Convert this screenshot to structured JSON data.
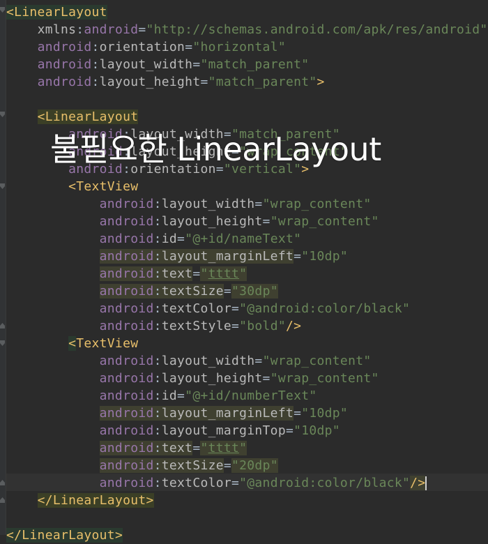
{
  "overlay_caption": "불필요한 LinearLayout",
  "lines": [
    {
      "indent": "",
      "parts": [
        {
          "c": "bracket tagbg2",
          "t": "<"
        },
        {
          "c": "tag tagbg2",
          "t": "LinearLayout"
        }
      ]
    },
    {
      "indent": "    ",
      "parts": [
        {
          "c": "plain",
          "t": "xmlns"
        },
        {
          "c": "colon",
          "t": ":"
        },
        {
          "c": "attr",
          "t": "android"
        },
        {
          "c": "eq",
          "t": "="
        },
        {
          "c": "val",
          "t": "\"http://schemas.android.com/apk/res/android\""
        }
      ]
    },
    {
      "indent": "    ",
      "parts": [
        {
          "c": "attr",
          "t": "android"
        },
        {
          "c": "colon",
          "t": ":"
        },
        {
          "c": "plain",
          "t": "orientation"
        },
        {
          "c": "eq",
          "t": "="
        },
        {
          "c": "val",
          "t": "\"horizontal\""
        }
      ]
    },
    {
      "indent": "    ",
      "parts": [
        {
          "c": "attr",
          "t": "android"
        },
        {
          "c": "colon",
          "t": ":"
        },
        {
          "c": "plain",
          "t": "layout_width"
        },
        {
          "c": "eq",
          "t": "="
        },
        {
          "c": "val",
          "t": "\"match_parent\""
        }
      ]
    },
    {
      "indent": "    ",
      "parts": [
        {
          "c": "attr",
          "t": "android"
        },
        {
          "c": "colon",
          "t": ":"
        },
        {
          "c": "plain",
          "t": "layout_height"
        },
        {
          "c": "eq",
          "t": "="
        },
        {
          "c": "val",
          "t": "\"match_parent\""
        },
        {
          "c": "bracket",
          "t": ">"
        }
      ]
    },
    {
      "indent": "",
      "parts": []
    },
    {
      "indent": "    ",
      "parts": [
        {
          "c": "bracket tagbg",
          "t": "<"
        },
        {
          "c": "tag tagbg",
          "t": "LinearLayout"
        }
      ]
    },
    {
      "indent": "        ",
      "parts": [
        {
          "c": "attr",
          "t": "android"
        },
        {
          "c": "colon",
          "t": ":"
        },
        {
          "c": "plain",
          "t": "layout_width"
        },
        {
          "c": "eq",
          "t": "="
        },
        {
          "c": "val",
          "t": "\"match_parent\""
        }
      ]
    },
    {
      "indent": "        ",
      "parts": [
        {
          "c": "attr",
          "t": "android"
        },
        {
          "c": "colon",
          "t": ":"
        },
        {
          "c": "plain",
          "t": "layout_height"
        },
        {
          "c": "eq",
          "t": "="
        },
        {
          "c": "val",
          "t": "\"wrap_content\""
        }
      ]
    },
    {
      "indent": "        ",
      "parts": [
        {
          "c": "attr",
          "t": "android"
        },
        {
          "c": "colon",
          "t": ":"
        },
        {
          "c": "plain",
          "t": "orientation"
        },
        {
          "c": "eq",
          "t": "="
        },
        {
          "c": "val",
          "t": "\"vertical\""
        },
        {
          "c": "bracket",
          "t": ">"
        }
      ]
    },
    {
      "indent": "        ",
      "parts": [
        {
          "c": "bracket",
          "t": "<"
        },
        {
          "c": "tag",
          "t": "TextView"
        }
      ]
    },
    {
      "indent": "            ",
      "parts": [
        {
          "c": "attr",
          "t": "android"
        },
        {
          "c": "colon",
          "t": ":"
        },
        {
          "c": "plain",
          "t": "layout_width"
        },
        {
          "c": "eq",
          "t": "="
        },
        {
          "c": "val",
          "t": "\"wrap_content\""
        }
      ]
    },
    {
      "indent": "            ",
      "parts": [
        {
          "c": "attr",
          "t": "android"
        },
        {
          "c": "colon",
          "t": ":"
        },
        {
          "c": "plain",
          "t": "layout_height"
        },
        {
          "c": "eq",
          "t": "="
        },
        {
          "c": "val",
          "t": "\"wrap_content\""
        }
      ]
    },
    {
      "indent": "            ",
      "parts": [
        {
          "c": "attr",
          "t": "android"
        },
        {
          "c": "colon",
          "t": ":"
        },
        {
          "c": "plain",
          "t": "id"
        },
        {
          "c": "eq",
          "t": "="
        },
        {
          "c": "val",
          "t": "\"@+id/nameText\""
        }
      ]
    },
    {
      "indent": "            ",
      "parts": [
        {
          "c": "attr attrbg",
          "t": "android"
        },
        {
          "c": "colon attrbg",
          "t": ":"
        },
        {
          "c": "plain attrbg",
          "t": "layout_marginLeft"
        },
        {
          "c": "eq",
          "t": "="
        },
        {
          "c": "val",
          "t": "\"10dp\""
        }
      ]
    },
    {
      "indent": "            ",
      "parts": [
        {
          "c": "attr attrbg",
          "t": "android"
        },
        {
          "c": "colon attrbg",
          "t": ":"
        },
        {
          "c": "plain attrbg",
          "t": "text"
        },
        {
          "c": "eq",
          "t": "="
        },
        {
          "c": "val valbg",
          "t": "\""
        },
        {
          "c": "val valbg link",
          "t": "tttt"
        },
        {
          "c": "val valbg",
          "t": "\""
        }
      ]
    },
    {
      "indent": "            ",
      "parts": [
        {
          "c": "attr attrbg",
          "t": "android"
        },
        {
          "c": "colon attrbg",
          "t": ":"
        },
        {
          "c": "plain attrbg",
          "t": "textSize"
        },
        {
          "c": "eq",
          "t": "="
        },
        {
          "c": "val valbg",
          "t": "\"30dp\""
        }
      ]
    },
    {
      "indent": "            ",
      "parts": [
        {
          "c": "attr",
          "t": "android"
        },
        {
          "c": "colon",
          "t": ":"
        },
        {
          "c": "plain",
          "t": "textColor"
        },
        {
          "c": "eq",
          "t": "="
        },
        {
          "c": "val",
          "t": "\"@android:color/black\""
        }
      ]
    },
    {
      "indent": "            ",
      "parts": [
        {
          "c": "attr",
          "t": "android"
        },
        {
          "c": "colon",
          "t": ":"
        },
        {
          "c": "plain",
          "t": "textStyle"
        },
        {
          "c": "eq",
          "t": "="
        },
        {
          "c": "val",
          "t": "\"bold\""
        },
        {
          "c": "bracket",
          "t": "/>"
        }
      ]
    },
    {
      "indent": "        ",
      "parts": [
        {
          "c": "bracket tagbg2",
          "t": "<"
        },
        {
          "c": "tag",
          "t": "TextView"
        }
      ]
    },
    {
      "indent": "            ",
      "parts": [
        {
          "c": "attr",
          "t": "android"
        },
        {
          "c": "colon",
          "t": ":"
        },
        {
          "c": "plain",
          "t": "layout_width"
        },
        {
          "c": "eq",
          "t": "="
        },
        {
          "c": "val",
          "t": "\"wrap_content\""
        }
      ]
    },
    {
      "indent": "            ",
      "parts": [
        {
          "c": "attr",
          "t": "android"
        },
        {
          "c": "colon",
          "t": ":"
        },
        {
          "c": "plain",
          "t": "layout_height"
        },
        {
          "c": "eq",
          "t": "="
        },
        {
          "c": "val",
          "t": "\"wrap_content\""
        }
      ]
    },
    {
      "indent": "            ",
      "parts": [
        {
          "c": "attr",
          "t": "android"
        },
        {
          "c": "colon",
          "t": ":"
        },
        {
          "c": "plain",
          "t": "id"
        },
        {
          "c": "eq",
          "t": "="
        },
        {
          "c": "val",
          "t": "\"@+id/numberText\""
        }
      ]
    },
    {
      "indent": "            ",
      "parts": [
        {
          "c": "attr attrbg",
          "t": "android"
        },
        {
          "c": "colon attrbg",
          "t": ":"
        },
        {
          "c": "plain attrbg",
          "t": "layout_marginLeft"
        },
        {
          "c": "eq",
          "t": "="
        },
        {
          "c": "val",
          "t": "\"10dp\""
        }
      ]
    },
    {
      "indent": "            ",
      "parts": [
        {
          "c": "attr",
          "t": "android"
        },
        {
          "c": "colon",
          "t": ":"
        },
        {
          "c": "plain",
          "t": "layout_marginTop"
        },
        {
          "c": "eq",
          "t": "="
        },
        {
          "c": "val",
          "t": "\"10dp\""
        }
      ]
    },
    {
      "indent": "            ",
      "parts": [
        {
          "c": "attr attrbg",
          "t": "android"
        },
        {
          "c": "colon attrbg",
          "t": ":"
        },
        {
          "c": "plain attrbg",
          "t": "text"
        },
        {
          "c": "eq",
          "t": "="
        },
        {
          "c": "val valbg",
          "t": "\""
        },
        {
          "c": "val valbg link",
          "t": "tttt"
        },
        {
          "c": "val valbg",
          "t": "\""
        }
      ]
    },
    {
      "indent": "            ",
      "parts": [
        {
          "c": "attr attrbg",
          "t": "android"
        },
        {
          "c": "colon attrbg",
          "t": ":"
        },
        {
          "c": "plain attrbg",
          "t": "textSize"
        },
        {
          "c": "eq",
          "t": "="
        },
        {
          "c": "val valbg",
          "t": "\"20dp\""
        }
      ]
    },
    {
      "indent": "            ",
      "parts": [
        {
          "c": "attr",
          "t": "android"
        },
        {
          "c": "colon",
          "t": ":"
        },
        {
          "c": "plain",
          "t": "textColor"
        },
        {
          "c": "eq",
          "t": "="
        },
        {
          "c": "val",
          "t": "\"@android:color/black\""
        },
        {
          "c": "bracket attrbg",
          "t": "/>"
        }
      ]
    },
    {
      "indent": "    ",
      "parts": [
        {
          "c": "bracket tagbg",
          "t": "</"
        },
        {
          "c": "tag tagbg",
          "t": "LinearLayout"
        },
        {
          "c": "bracket tagbg",
          "t": ">"
        }
      ]
    },
    {
      "indent": "",
      "parts": []
    },
    {
      "indent": "",
      "parts": [
        {
          "c": "bracket tagbg2",
          "t": "</"
        },
        {
          "c": "tag tagbg2",
          "t": "LinearLayout"
        },
        {
          "c": "bracket tagbg2",
          "t": ">"
        }
      ]
    }
  ]
}
